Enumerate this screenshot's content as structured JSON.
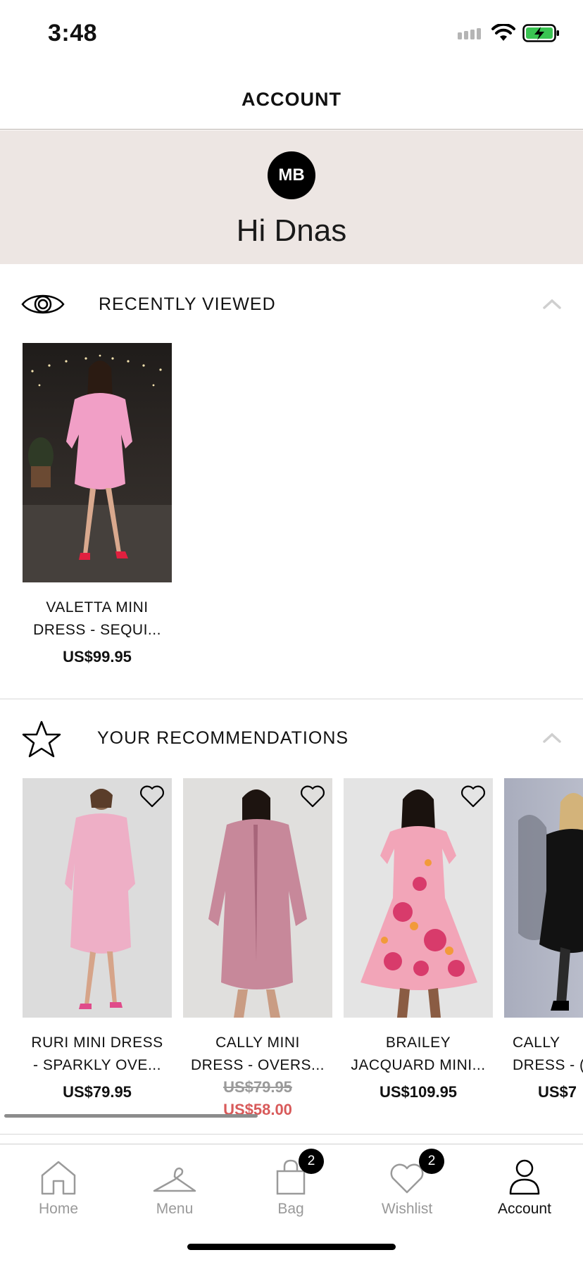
{
  "status_bar": {
    "time": "3:48"
  },
  "header": {
    "title": "ACCOUNT"
  },
  "greeting": {
    "initials": "MB",
    "text": "Hi Dnas"
  },
  "recently_viewed": {
    "title": "RECENTLY VIEWED",
    "items": [
      {
        "name_line1": "VALETTA MINI",
        "name_line2": "DRESS - SEQUI...",
        "price": "US$99.95"
      }
    ]
  },
  "recommendations": {
    "title": "YOUR RECOMMENDATIONS",
    "items": [
      {
        "name_line1": "RURI MINI DRESS",
        "name_line2": "- SPARKLY OVE...",
        "price": "US$79.95"
      },
      {
        "name_line1": "CALLY MINI",
        "name_line2": "DRESS - OVERS...",
        "price_old": "US$79.95",
        "price_sale": "US$58.00"
      },
      {
        "name_line1": "BRAILEY",
        "name_line2": "JACQUARD MINI...",
        "price": "US$109.95"
      },
      {
        "name_line1": "CALLY",
        "name_line2": "DRESS - (",
        "price": "US$7"
      }
    ]
  },
  "tab_bar": {
    "tabs": [
      {
        "label": "Home",
        "icon": "home-icon"
      },
      {
        "label": "Menu",
        "icon": "hanger-icon"
      },
      {
        "label": "Bag",
        "icon": "bag-icon",
        "badge": "2"
      },
      {
        "label": "Wishlist",
        "icon": "heart-icon",
        "badge": "2"
      },
      {
        "label": "Account",
        "icon": "person-icon",
        "active": true
      }
    ]
  },
  "colors": {
    "accent": "#000000",
    "greeting_bg": "#ede6e3",
    "sale": "#d85a5a",
    "inactive_tab": "#999999"
  }
}
